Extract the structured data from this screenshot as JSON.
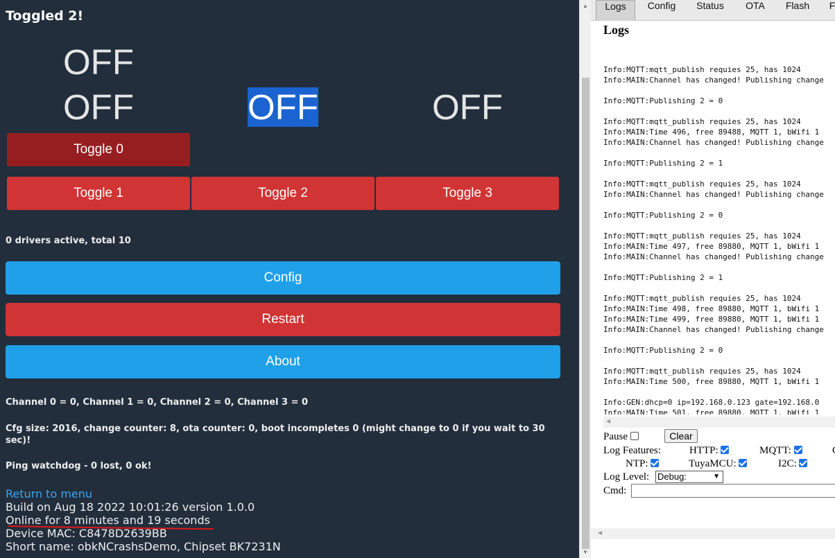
{
  "left": {
    "title": "Toggled 2!",
    "states": [
      "OFF",
      "OFF",
      "OFF",
      "OFF"
    ],
    "toggle_buttons": [
      "Toggle 0",
      "Toggle 1",
      "Toggle 2",
      "Toggle 3"
    ],
    "drivers_text": "0 drivers active, total 10",
    "buttons": {
      "config": "Config",
      "restart": "Restart",
      "about": "About"
    },
    "channels_text": "Channel 0 = 0, Channel 1 = 0, Channel 2 = 0, Channel 3 = 0",
    "cfg_text": "Cfg size: 2016, change counter: 8, ota counter: 0, boot incompletes 0 (might change to 0 if you wait to 30 sec)!",
    "ping_text": "Ping watchdog - 0 lost, 0 ok!",
    "menu_link": "Return to menu",
    "build_text": "Build on Aug 18 2022 10:01:26 version 1.0.0",
    "online_text": "Online for 8 minutes and 19 seconds",
    "mac_text": "Device MAC: C8478D2639BB",
    "short_name_text": "Short name: obkNCrashsDemo, Chipset BK7231N",
    "colors": {
      "bg": "#222e3c",
      "red": "#d13434",
      "dark_red": "#971e20",
      "blue": "#20a0e8",
      "highlight": "#1a63d0"
    }
  },
  "right": {
    "tabs": [
      "Logs",
      "Config",
      "Status",
      "OTA",
      "Flash",
      "F"
    ],
    "active_tab": "Logs",
    "title": "Logs",
    "log_lines": [
      "",
      "Info:MQTT:mqtt_publish requies 25, has 1024",
      "Info:MAIN:Channel has changed! Publishing change",
      "",
      "Info:MQTT:Publishing 2 = 0",
      "",
      "Info:MQTT:mqtt_publish requies 25, has 1024",
      "Info:MAIN:Time 496, free 89488, MQTT 1, bWifi 1",
      "Info:MAIN:Channel has changed! Publishing change",
      "",
      "Info:MQTT:Publishing 2 = 1",
      "",
      "Info:MQTT:mqtt_publish requies 25, has 1024",
      "Info:MAIN:Channel has changed! Publishing change",
      "",
      "Info:MQTT:Publishing 2 = 0",
      "",
      "Info:MQTT:mqtt_publish requies 25, has 1024",
      "Info:MAIN:Time 497, free 89880, MQTT 1, bWifi 1",
      "Info:MAIN:Channel has changed! Publishing change",
      "",
      "Info:MQTT:Publishing 2 = 1",
      "",
      "Info:MQTT:mqtt_publish requies 25, has 1024",
      "Info:MAIN:Time 498, free 89880, MQTT 1, bWifi 1",
      "Info:MAIN:Time 499, free 89880, MQTT 1, bWifi 1",
      "Info:MAIN:Channel has changed! Publishing change",
      "",
      "Info:MQTT:Publishing 2 = 0",
      "",
      "Info:MQTT:mqtt_publish requies 25, has 1024",
      "Info:MAIN:Time 500, free 89880, MQTT 1, bWifi 1",
      "",
      "Info:GEN:dhcp=0 ip=192.168.0.123 gate=192.168.0",
      "Info:MAIN:Time 501, free 89880, MQTT 1, bWifi 1"
    ],
    "pause_label": "Pause",
    "clear_label": "Clear",
    "features_label": "Log Features:",
    "features": [
      {
        "name": "HTTP:",
        "checked": true
      },
      {
        "name": "MQTT:",
        "checked": true
      },
      {
        "name": "C",
        "checked": false
      },
      {
        "name": "NTP:",
        "checked": true
      },
      {
        "name": "TuyaMCU:",
        "checked": true
      },
      {
        "name": "I2C:",
        "checked": true
      }
    ],
    "level_label": "Log Level:",
    "level_value": "Debug:",
    "cmd_label": "Cmd:"
  }
}
